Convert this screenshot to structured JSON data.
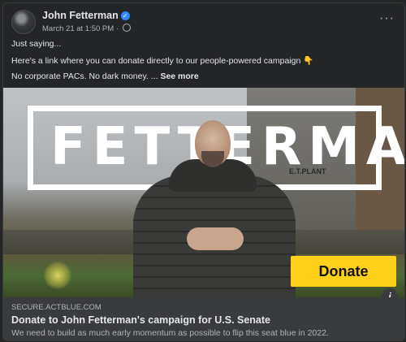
{
  "post": {
    "author": "John Fetterman",
    "verified_icon": "verified-badge-icon",
    "timestamp": "March 21 at 1:50 PM",
    "separator": "·",
    "privacy_icon": "globe-icon",
    "more_icon": "more-options-icon",
    "more_label": "···",
    "lines": [
      "Just saying...",
      "Here's a link where you can donate directly to our people-powered campaign",
      "No corporate PACs. No dark money. ..."
    ],
    "hand_emoji": "👇",
    "see_more": "See more"
  },
  "media": {
    "wordmark": "FETTERMAN",
    "plant_sign": "E.T.PLANT",
    "donate_label": "Donate",
    "info_label": "i"
  },
  "link": {
    "domain": "SECURE.ACTBLUE.COM",
    "title": "Donate to John Fetterman's campaign for U.S. Senate",
    "description": "We need to build as much early momentum as possible to flip this seat blue in 2022."
  },
  "colors": {
    "background": "#242526",
    "text_primary": "#e4e6eb",
    "text_secondary": "#b0b3b8",
    "donate_yellow": "#ffd11a",
    "verified_blue": "#2d88ff"
  }
}
